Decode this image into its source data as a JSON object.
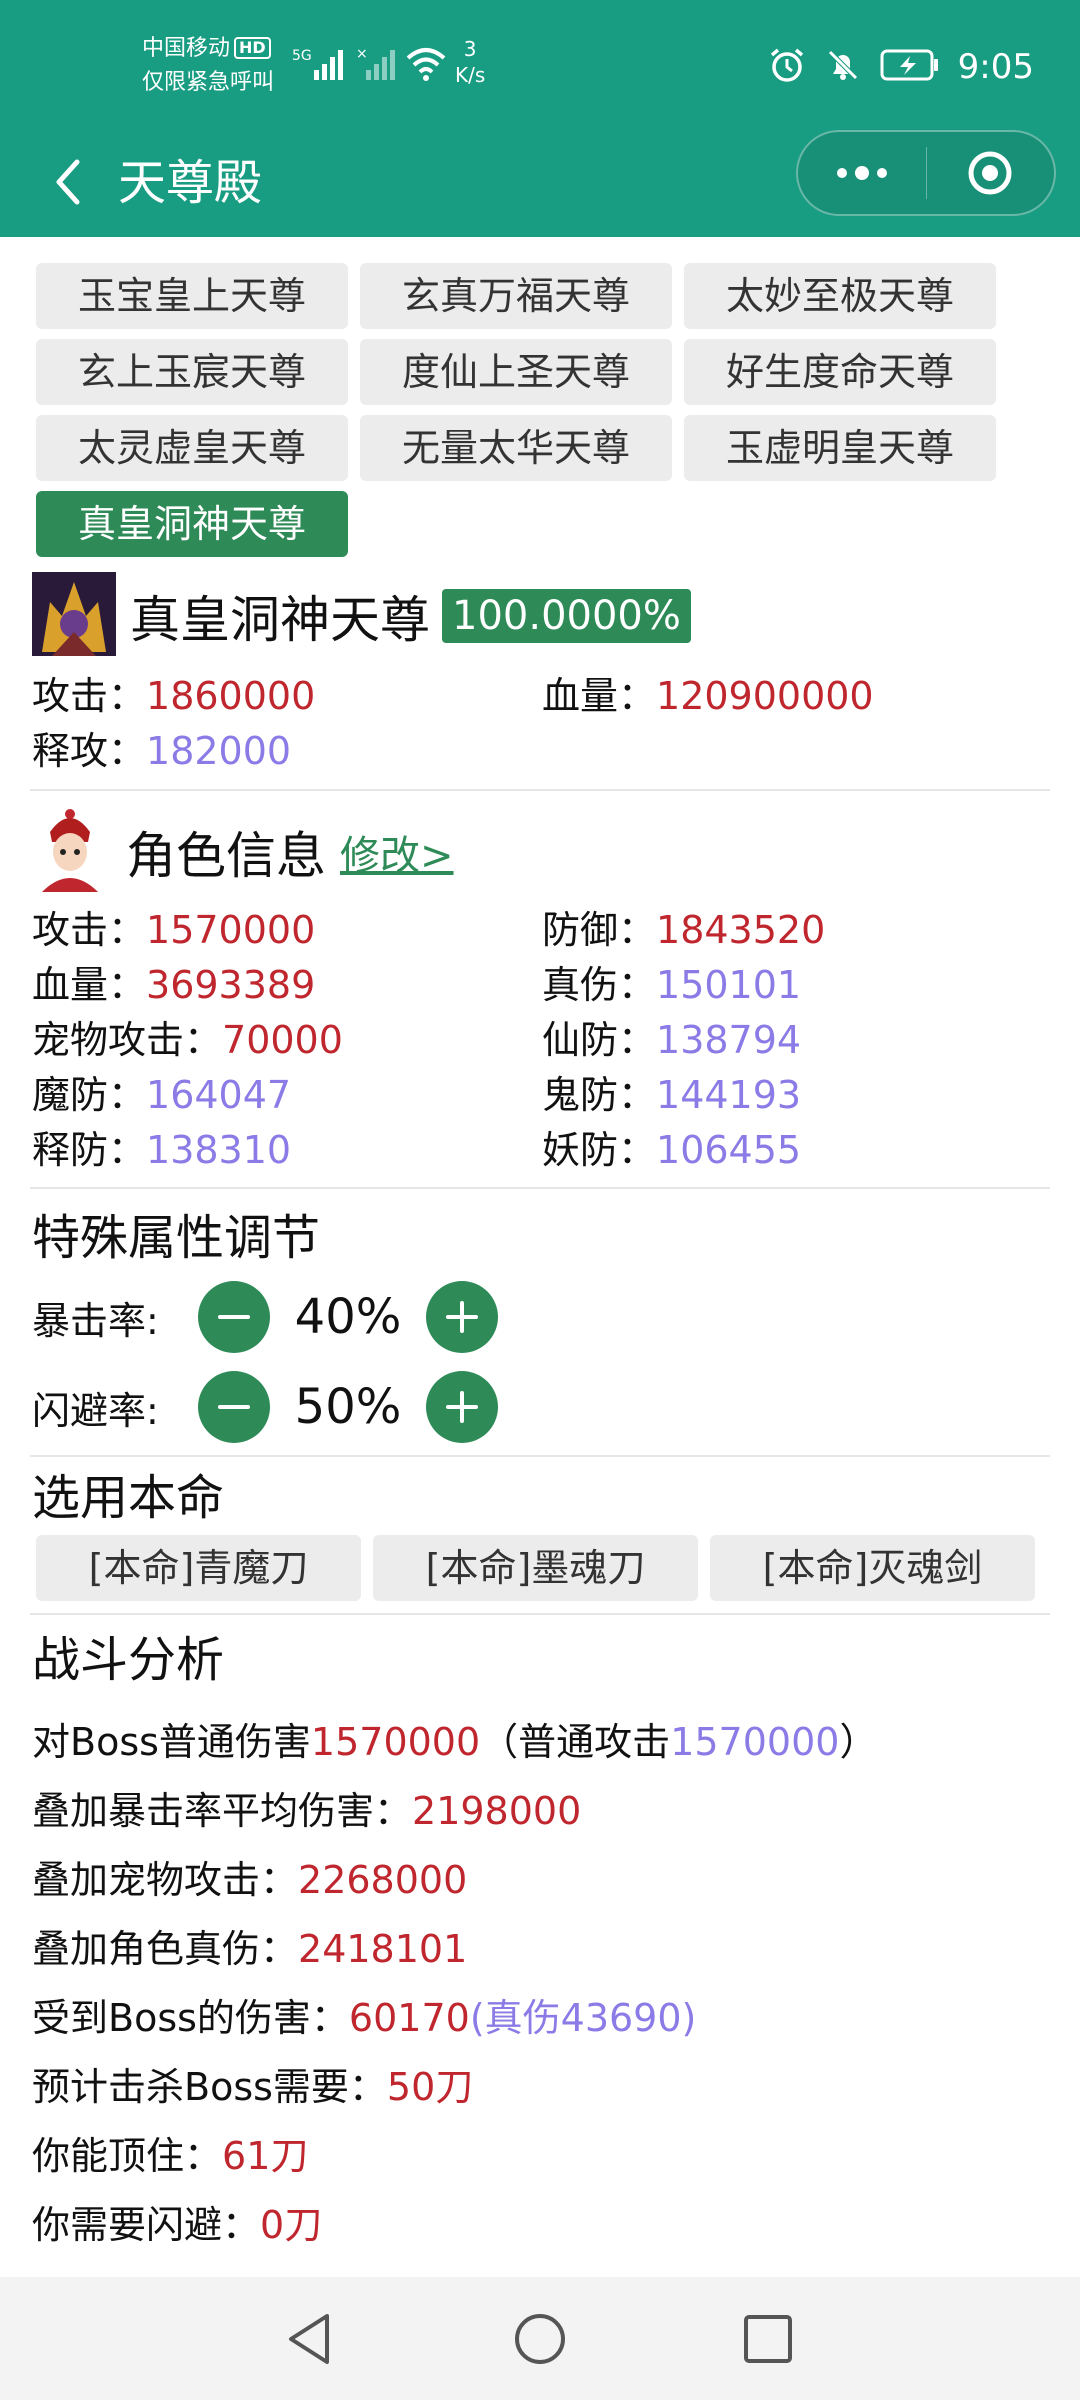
{
  "status_bar": {
    "carrier_line1": "中国移动",
    "hd_badge": "HD",
    "carrier_line2": "仅限紧急呼叫",
    "network_label": "5G",
    "net_speed_value": "3",
    "net_speed_unit": "K/s",
    "time": "9:05"
  },
  "title_bar": {
    "title": "天尊殿"
  },
  "tabs": [
    {
      "label": "玉宝皇上天尊"
    },
    {
      "label": "玄真万福天尊"
    },
    {
      "label": "太妙至极天尊"
    },
    {
      "label": "玄上玉宸天尊"
    },
    {
      "label": "度仙上圣天尊"
    },
    {
      "label": "好生度命天尊"
    },
    {
      "label": "太灵虚皇天尊"
    },
    {
      "label": "无量太华天尊"
    },
    {
      "label": "玉虚明皇天尊"
    },
    {
      "label": "真皇洞神天尊"
    }
  ],
  "boss": {
    "name": "真皇洞神天尊",
    "percent": "100.0000%",
    "attack_label": "攻击：",
    "attack": "1860000",
    "hp_label": "血量：",
    "hp": "120900000",
    "skill_label": "释攻：",
    "skill": "182000"
  },
  "role": {
    "title": "角色信息",
    "edit": "修改>",
    "stats": [
      {
        "label": "攻击：",
        "value": "1570000",
        "color": "red"
      },
      {
        "label": "防御：",
        "value": "1843520",
        "color": "red"
      },
      {
        "label": "血量：",
        "value": "3693389",
        "color": "red"
      },
      {
        "label": "真伤：",
        "value": "150101",
        "color": "purple"
      },
      {
        "label": "宠物攻击：",
        "value": "70000",
        "color": "red"
      },
      {
        "label": "仙防：",
        "value": "138794",
        "color": "purple"
      },
      {
        "label": "魔防：",
        "value": "164047",
        "color": "purple"
      },
      {
        "label": "鬼防：",
        "value": "144193",
        "color": "purple"
      },
      {
        "label": "释防：",
        "value": "138310",
        "color": "purple"
      },
      {
        "label": "妖防：",
        "value": "106455",
        "color": "purple"
      }
    ]
  },
  "special": {
    "title": "特殊属性调节",
    "crit_label": "暴击率:",
    "crit_value": "40%",
    "dodge_label": "闪避率:",
    "dodge_value": "50%"
  },
  "weapons": {
    "title": "选用本命",
    "items": [
      "[本命]青魔刀",
      "[本命]墨魂刀",
      "[本命]灭魂剑"
    ]
  },
  "analysis": {
    "title": "战斗分析",
    "l1_a": "对Boss普通伤害",
    "l1_b": "1570000",
    "l1_c": "（普通攻击",
    "l1_d": "1570000",
    "l1_e": "）",
    "l2_label": "叠加暴击率平均伤害：",
    "l2_value": "2198000",
    "l3_label": "叠加宠物攻击：",
    "l3_value": "2268000",
    "l4_label": "叠加角色真伤：",
    "l4_value": "2418101",
    "l5_label": "受到Boss的伤害：",
    "l5_value": "60170",
    "l5_extra": "(真伤43690)",
    "l6_label": "预计击杀Boss需要：",
    "l6_value": "50刀",
    "l7_label": "你能顶住：",
    "l7_value": "61刀",
    "l8_label": "你需要闪避：",
    "l8_value": "0刀"
  },
  "colors": {
    "header": "#199d82",
    "accent": "#2e8b57",
    "value_red": "#c0262d",
    "value_purple": "#8a7be6"
  }
}
